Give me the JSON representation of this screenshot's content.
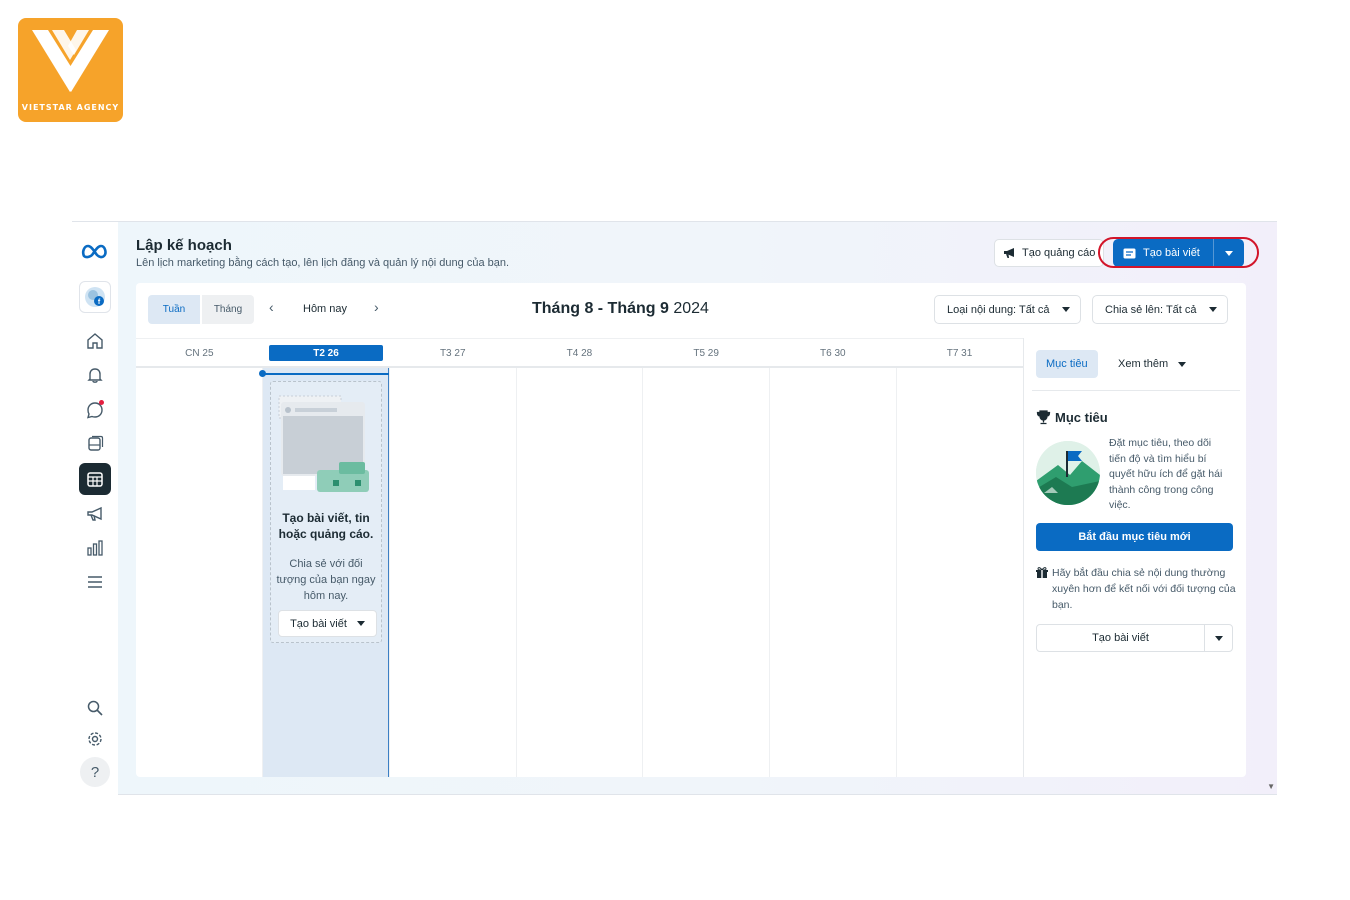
{
  "brand": {
    "logo_text": "VIETSTAR AGENCY",
    "color": "#f6a32a"
  },
  "header": {
    "title": "Lập kế hoạch",
    "subtitle": "Lên lịch marketing bằng cách tạo, lên lịch đăng và quản lý nội dung của bạn.",
    "create_ad_label": "Tạo quảng cáo",
    "create_post_label": "Tạo bài viết"
  },
  "nav": {
    "items": [
      "meta-logo",
      "page-avatar",
      "home-icon",
      "bell-icon",
      "chat-icon",
      "content-icon",
      "calendar-icon",
      "megaphone-icon",
      "insights-icon",
      "menu-icon",
      "search-icon",
      "gear-icon",
      "help-icon"
    ],
    "help_label": "?"
  },
  "toolbar": {
    "views": [
      "Tuần",
      "Tháng"
    ],
    "active_view": "Tuần",
    "today_label": "Hôm nay",
    "range_bold": "Tháng 8 - Tháng 9",
    "range_year": "2024",
    "filter_content": "Loại nội dung: Tất cả",
    "filter_share": "Chia sẻ lên: Tất cả"
  },
  "calendar": {
    "days": [
      "CN 25",
      "T2 26",
      "T3 27",
      "T4 28",
      "T5 29",
      "T6 30",
      "T7 31"
    ],
    "today_index": 1,
    "empty_card": {
      "title": "Tạo bài viết, tin hoặc quảng cáo.",
      "description": "Chia sẻ với đối tượng của bạn ngay hôm nay.",
      "button_label": "Tạo bài viết"
    }
  },
  "sidebar": {
    "tab_active": "Mục tiêu",
    "tab_more": "Xem thêm",
    "goal_title": "Mục tiêu",
    "goal_text": "Đặt mục tiêu, theo dõi tiến độ và tìm hiểu bí quyết hữu ích để gặt hái thành công trong công việc.",
    "goal_button": "Bắt đầu mục tiêu mới",
    "tip_text": "Hãy bắt đầu chia sẻ nội dung thường xuyên hơn để kết nối với đối tượng của bạn.",
    "create_button": "Tạo bài viết"
  },
  "colors": {
    "accent": "#0a6bc3",
    "highlight": "#d2152a",
    "today_bg": "#dde8f4"
  }
}
